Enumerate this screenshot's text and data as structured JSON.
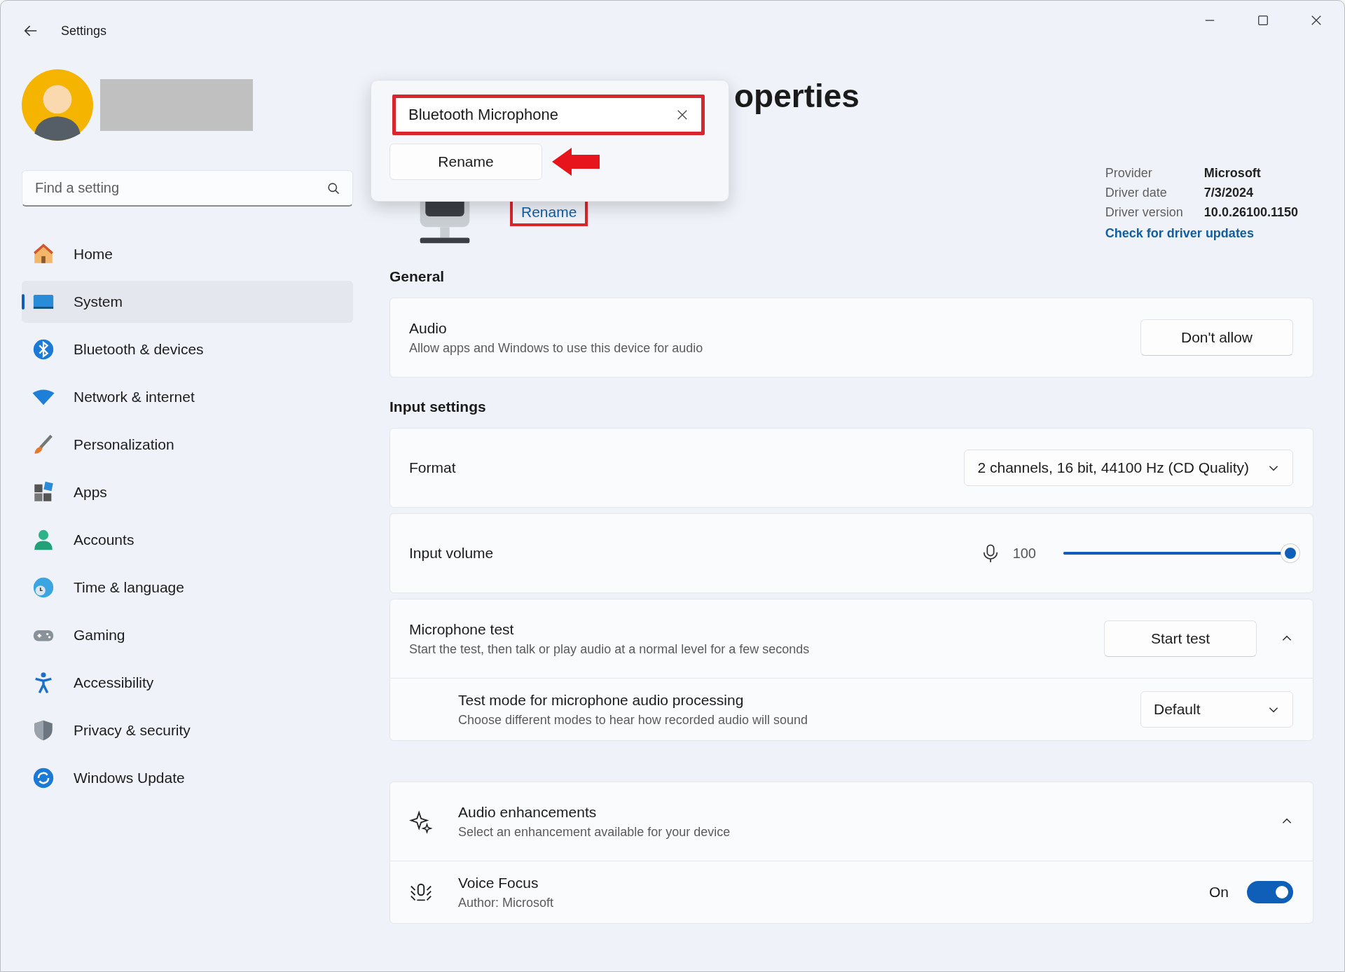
{
  "window": {
    "title": "Settings"
  },
  "search": {
    "placeholder": "Find a setting"
  },
  "nav": [
    {
      "label": "Home",
      "selected": false
    },
    {
      "label": "System",
      "selected": true
    },
    {
      "label": "Bluetooth & devices",
      "selected": false
    },
    {
      "label": "Network & internet",
      "selected": false
    },
    {
      "label": "Personalization",
      "selected": false
    },
    {
      "label": "Apps",
      "selected": false
    },
    {
      "label": "Accounts",
      "selected": false
    },
    {
      "label": "Time & language",
      "selected": false
    },
    {
      "label": "Gaming",
      "selected": false
    },
    {
      "label": "Accessibility",
      "selected": false
    },
    {
      "label": "Privacy & security",
      "selected": false
    },
    {
      "label": "Windows Update",
      "selected": false
    }
  ],
  "page": {
    "title": "operties",
    "rename_link": {
      "label": "Rename",
      "highlighted": true
    }
  },
  "driver_info": [
    {
      "label": "Provider",
      "value": "Microsoft"
    },
    {
      "label": "Driver date",
      "value": "7/3/2024"
    },
    {
      "label": "Driver version",
      "value": "10.0.26100.1150"
    }
  ],
  "driver_link": "Check for driver updates",
  "sections": [
    {
      "heading": "General",
      "cards": [
        {
          "kind": "button",
          "title": "Audio",
          "subtitle": "Allow apps and Windows to use this device for audio",
          "button": "Don't allow"
        }
      ]
    },
    {
      "heading": "Input settings",
      "cards": [
        {
          "kind": "dropdown",
          "title": "Format",
          "value": "2 channels, 16 bit, 44100 Hz (CD Quality)"
        },
        {
          "kind": "slider",
          "title": "Input volume",
          "reading": "100",
          "level": 1
        },
        {
          "kind": "expander",
          "title": "Microphone test",
          "subtitle": "Start the test, then talk or play audio at a normal level for a few seconds",
          "button": "Start test",
          "expanded": true,
          "children": [
            {
              "kind": "dropdown",
              "title": "Test mode for microphone audio processing",
              "subtitle": "Choose different modes to hear how recorded audio will sound",
              "value": "Default"
            }
          ]
        }
      ]
    },
    {
      "cards": [
        {
          "kind": "expander",
          "title": "Audio enhancements",
          "subtitle": "Select an enhancement available for your device",
          "expanded": true,
          "children": [
            {
              "kind": "toggle",
              "title": "Voice Focus",
              "subtitle": "Author: Microsoft",
              "state_label": "On",
              "on": true
            }
          ]
        }
      ]
    }
  ],
  "rename_popup": {
    "value": "Bluetooth Microphone",
    "highlighted": true,
    "button": "Rename",
    "arrow": true
  }
}
